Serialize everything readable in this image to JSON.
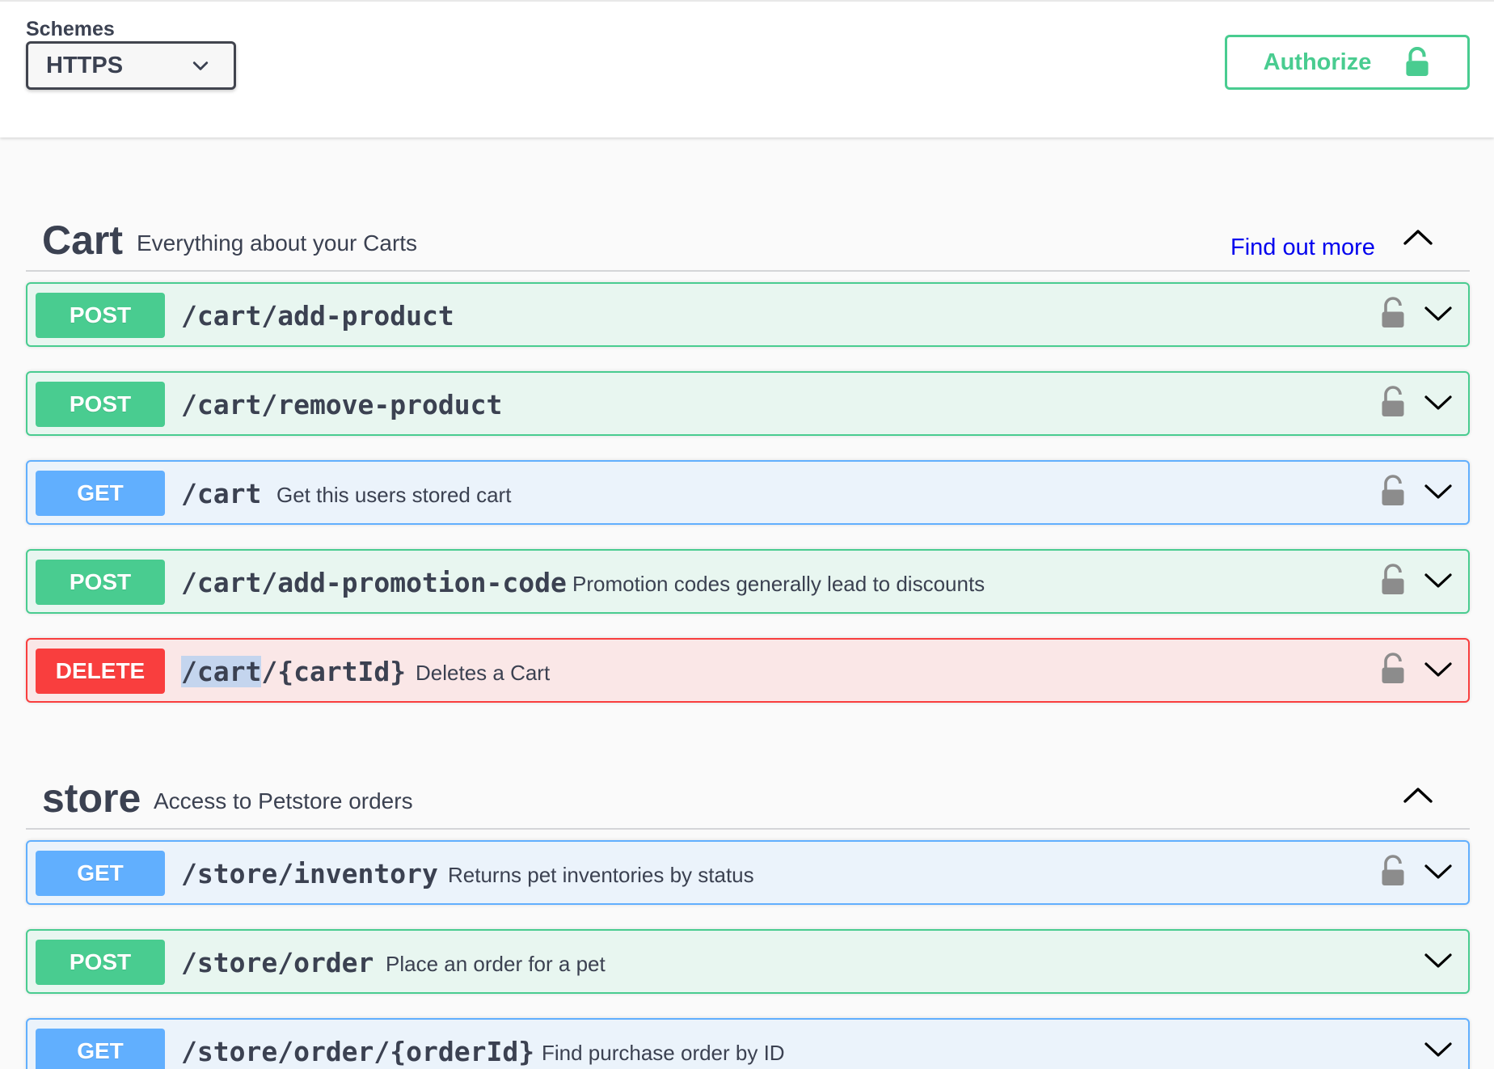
{
  "schemes": {
    "label": "Schemes",
    "selected": "HTTPS"
  },
  "authorize": {
    "label": "Authorize",
    "icon": "lock-open-icon",
    "color": "#49cc90"
  },
  "colors": {
    "post": "#49cc90",
    "get": "#61affe",
    "delete": "#f93e3e",
    "link": "#0000ee"
  },
  "sections": [
    {
      "name": "Cart",
      "description": "Everything about your Carts",
      "link": "Find out more",
      "operations": [
        {
          "method": "POST",
          "path": "/cart/add-product",
          "summary": ""
        },
        {
          "method": "POST",
          "path": "/cart/remove-product",
          "summary": ""
        },
        {
          "method": "GET",
          "path": "/cart",
          "summary": "Get this users stored cart"
        },
        {
          "method": "POST",
          "path": "/cart/add-promotion-code",
          "summary": "Promotion codes generally lead to discounts"
        },
        {
          "method": "DELETE",
          "path_selected": "/cart",
          "path_rest": "/{cartId}",
          "summary": "Deletes a Cart"
        }
      ]
    },
    {
      "name": "store",
      "description": "Access to Petstore orders",
      "operations": [
        {
          "method": "GET",
          "path": "/store/inventory",
          "summary": "Returns pet inventories by status"
        },
        {
          "method": "POST",
          "path": "/store/order",
          "summary": "Place an order for a pet"
        },
        {
          "method": "GET",
          "path": "/store/order/{orderId}",
          "summary": "Find purchase order by ID"
        }
      ]
    }
  ]
}
